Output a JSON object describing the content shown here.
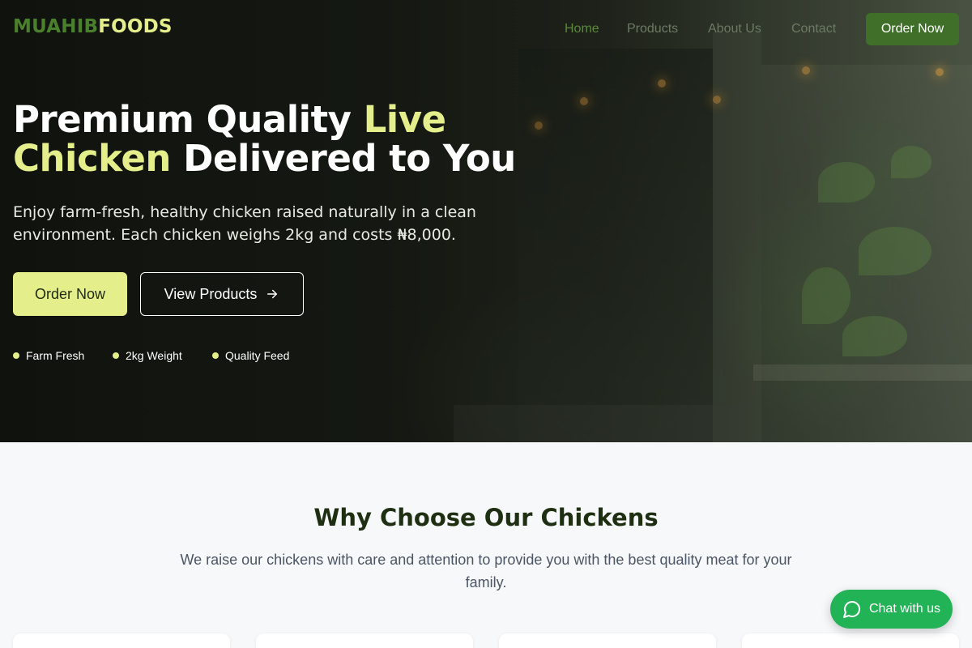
{
  "brand": {
    "part1": "MUAHIB",
    "part2": "FOODS"
  },
  "nav": {
    "links": [
      "Home",
      "Products",
      "About Us",
      "Contact"
    ],
    "cta": "Order Now"
  },
  "hero": {
    "title_a": "Premium Quality ",
    "title_hl1": "Live",
    "title_hl2": "Chicken",
    "title_b": " Delivered to You",
    "description": "Enjoy farm-fresh, healthy chicken raised naturally in a clean environment. Each chicken weighs 2kg and costs ₦8,000.",
    "primary_button": "Order Now",
    "secondary_button": "View Products",
    "features": [
      "Farm Fresh",
      "2kg Weight",
      "Quality Feed"
    ]
  },
  "why": {
    "title": "Why Choose Our Chickens",
    "subtitle": "We raise our chickens with care and attention to provide you with the best quality meat for your family."
  },
  "chat": {
    "label": "Chat with us"
  },
  "colors": {
    "accent": "#e4ee8a",
    "brand_green": "#3f6f28",
    "chat_green": "#22b357"
  }
}
